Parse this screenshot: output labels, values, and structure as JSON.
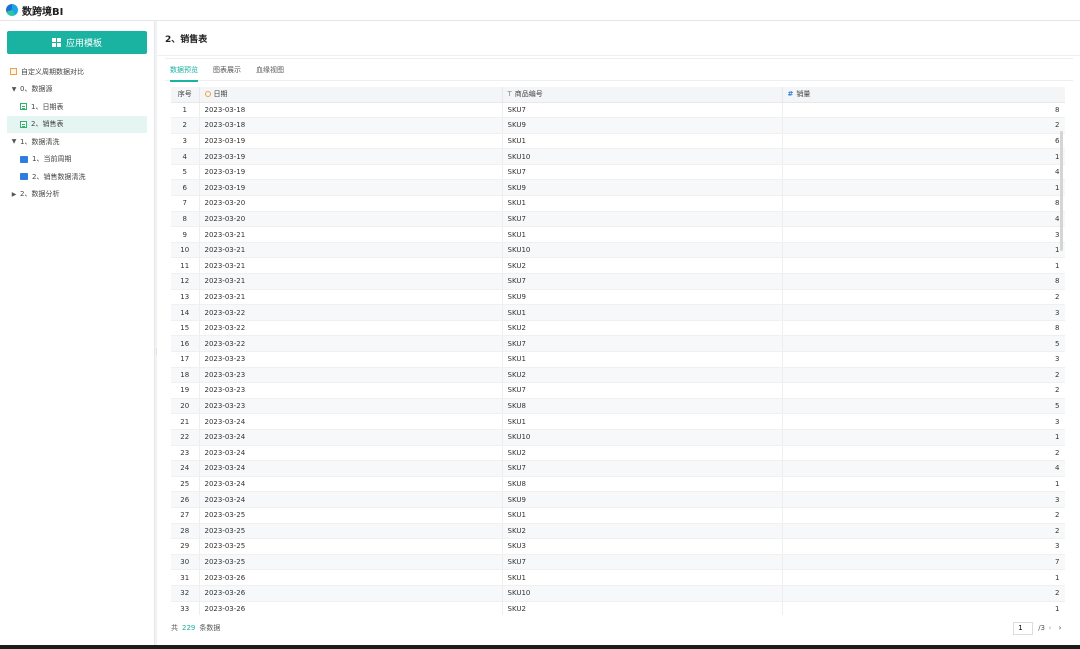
{
  "app": {
    "title": "数跨境BI"
  },
  "sidebar": {
    "app_button": "应用模板",
    "items": [
      {
        "label": "自定义周期数据对比",
        "icon": "calendar-icon"
      },
      {
        "label": "0、数据源",
        "caret": "▼"
      },
      {
        "label": "1、日期表",
        "icon": "table-icon"
      },
      {
        "label": "2、销售表",
        "icon": "table-icon"
      },
      {
        "label": "1、数据清洗",
        "caret": "▼"
      },
      {
        "label": "1、当前周期",
        "icon": "chart-icon"
      },
      {
        "label": "2、销售数据清洗",
        "icon": "chart-icon"
      },
      {
        "label": "2、数据分析",
        "caret": "▶"
      }
    ]
  },
  "main": {
    "title": "2、销售表",
    "tabs": [
      "数据预览",
      "图表展示",
      "血缘视图"
    ],
    "table": {
      "headers": [
        "序号",
        "日期",
        "商品编号",
        "销量"
      ],
      "rows": [
        [
          "1",
          "2023-03-18",
          "SKU7",
          "8"
        ],
        [
          "2",
          "2023-03-18",
          "SKU9",
          "2"
        ],
        [
          "3",
          "2023-03-19",
          "SKU1",
          "6"
        ],
        [
          "4",
          "2023-03-19",
          "SKU10",
          "1"
        ],
        [
          "5",
          "2023-03-19",
          "SKU7",
          "4"
        ],
        [
          "6",
          "2023-03-19",
          "SKU9",
          "1"
        ],
        [
          "7",
          "2023-03-20",
          "SKU1",
          "8"
        ],
        [
          "8",
          "2023-03-20",
          "SKU7",
          "4"
        ],
        [
          "9",
          "2023-03-21",
          "SKU1",
          "3"
        ],
        [
          "10",
          "2023-03-21",
          "SKU10",
          "1"
        ],
        [
          "11",
          "2023-03-21",
          "SKU2",
          "1"
        ],
        [
          "12",
          "2023-03-21",
          "SKU7",
          "8"
        ],
        [
          "13",
          "2023-03-21",
          "SKU9",
          "2"
        ],
        [
          "14",
          "2023-03-22",
          "SKU1",
          "3"
        ],
        [
          "15",
          "2023-03-22",
          "SKU2",
          "8"
        ],
        [
          "16",
          "2023-03-22",
          "SKU7",
          "5"
        ],
        [
          "17",
          "2023-03-23",
          "SKU1",
          "3"
        ],
        [
          "18",
          "2023-03-23",
          "SKU2",
          "2"
        ],
        [
          "19",
          "2023-03-23",
          "SKU7",
          "2"
        ],
        [
          "20",
          "2023-03-23",
          "SKU8",
          "5"
        ],
        [
          "21",
          "2023-03-24",
          "SKU1",
          "3"
        ],
        [
          "22",
          "2023-03-24",
          "SKU10",
          "1"
        ],
        [
          "23",
          "2023-03-24",
          "SKU2",
          "2"
        ],
        [
          "24",
          "2023-03-24",
          "SKU7",
          "4"
        ],
        [
          "25",
          "2023-03-24",
          "SKU8",
          "1"
        ],
        [
          "26",
          "2023-03-24",
          "SKU9",
          "3"
        ],
        [
          "27",
          "2023-03-25",
          "SKU1",
          "2"
        ],
        [
          "28",
          "2023-03-25",
          "SKU2",
          "2"
        ],
        [
          "29",
          "2023-03-25",
          "SKU3",
          "3"
        ],
        [
          "30",
          "2023-03-25",
          "SKU7",
          "7"
        ],
        [
          "31",
          "2023-03-26",
          "SKU1",
          "1"
        ],
        [
          "32",
          "2023-03-26",
          "SKU10",
          "2"
        ],
        [
          "33",
          "2023-03-26",
          "SKU2",
          "1"
        ]
      ]
    },
    "footer": {
      "prefix": "共",
      "total": "229",
      "suffix": "条数据",
      "page": "1",
      "page_total": "/3"
    }
  }
}
